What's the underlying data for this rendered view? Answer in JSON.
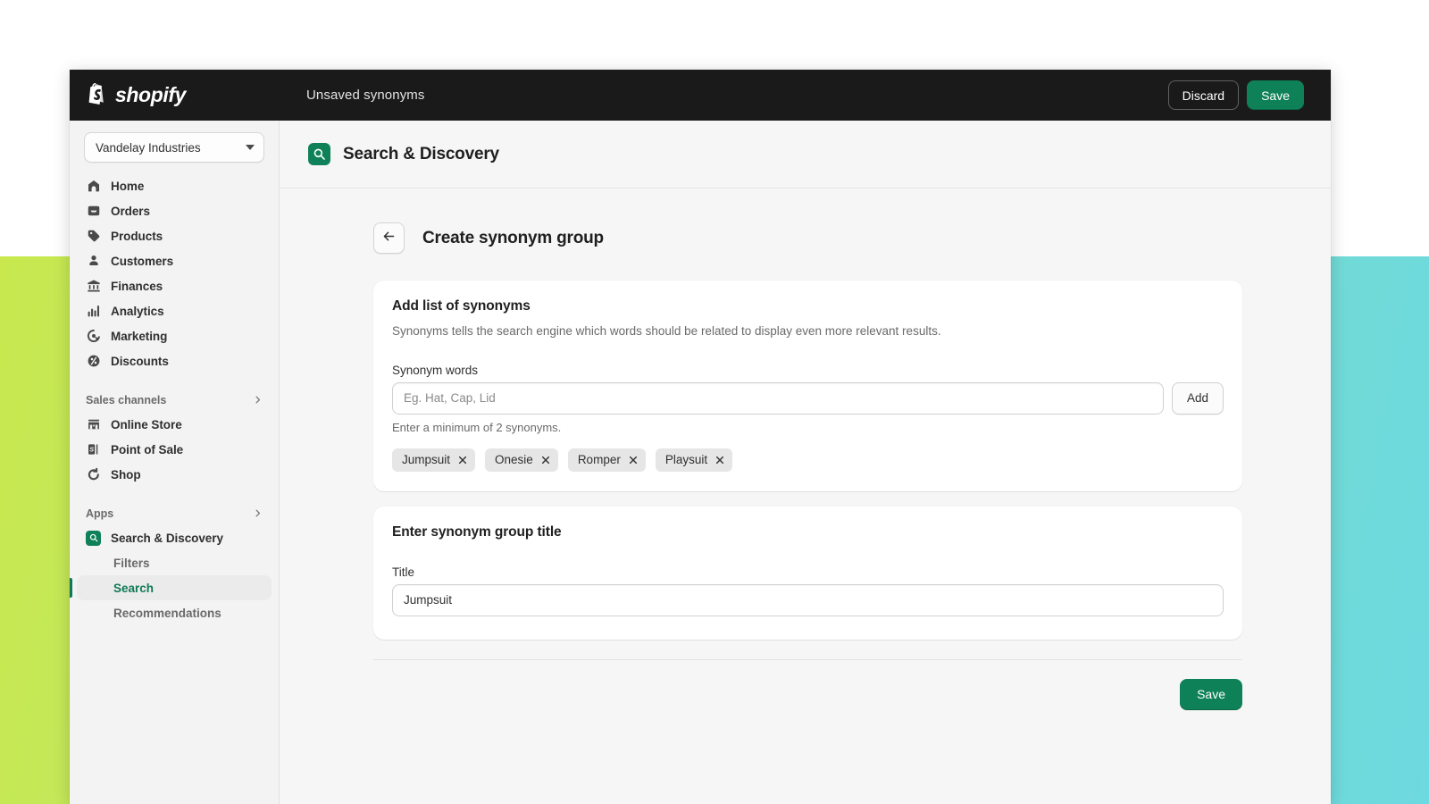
{
  "topbar": {
    "brand": "shopify",
    "brand_icon": "shopify-bag-icon",
    "title": "Unsaved synonyms",
    "discard_label": "Discard",
    "save_label": "Save"
  },
  "sidebar": {
    "store": {
      "name": "Vandelay Industries",
      "caret_icon": "chevron-down-icon"
    },
    "nav": [
      {
        "label": "Home",
        "icon": "home-icon"
      },
      {
        "label": "Orders",
        "icon": "orders-inbox-icon"
      },
      {
        "label": "Products",
        "icon": "product-tag-icon"
      },
      {
        "label": "Customers",
        "icon": "person-icon"
      },
      {
        "label": "Finances",
        "icon": "bank-icon"
      },
      {
        "label": "Analytics",
        "icon": "bar-chart-icon"
      },
      {
        "label": "Marketing",
        "icon": "megaphone-target-icon"
      },
      {
        "label": "Discounts",
        "icon": "discount-percent-icon"
      }
    ],
    "sales_channels": {
      "label": "Sales channels",
      "chevron_icon": "chevron-right-icon",
      "items": [
        {
          "label": "Online Store",
          "icon": "storefront-icon"
        },
        {
          "label": "Point of Sale",
          "icon": "pos-device-icon"
        },
        {
          "label": "Shop",
          "icon": "shop-bag-icon"
        }
      ]
    },
    "apps": {
      "label": "Apps",
      "chevron_icon": "chevron-right-icon",
      "items": [
        {
          "label": "Search & Discovery",
          "icon": "search-discovery-app-icon"
        }
      ],
      "sub_items": [
        {
          "label": "Filters",
          "active": false
        },
        {
          "label": "Search",
          "active": true
        },
        {
          "label": "Recommendations",
          "active": false
        }
      ]
    }
  },
  "app_header": {
    "icon": "search-discovery-app-icon",
    "title": "Search & Discovery"
  },
  "page": {
    "back_icon": "arrow-left-icon",
    "title": "Create synonym group"
  },
  "synonyms_card": {
    "title": "Add list of synonyms",
    "description": "Synonyms tells the search engine which words should be related to display even more relevant results.",
    "field_label": "Synonym words",
    "input_value": "",
    "input_placeholder": "Eg. Hat, Cap, Lid",
    "add_label": "Add",
    "help_text": "Enter a minimum of 2 synonyms.",
    "chips": [
      {
        "label": "Jumpsuit",
        "remove_icon": "close-icon"
      },
      {
        "label": "Onesie",
        "remove_icon": "close-icon"
      },
      {
        "label": "Romper",
        "remove_icon": "close-icon"
      },
      {
        "label": "Playsuit",
        "remove_icon": "close-icon"
      }
    ]
  },
  "title_card": {
    "title": "Enter synonym group title",
    "field_label": "Title",
    "input_value": "Jumpsuit",
    "input_placeholder": ""
  },
  "footer": {
    "save_label": "Save"
  },
  "colors": {
    "brand_green": "#0f8159",
    "active_green": "#0f7a56",
    "topbar_black": "#1a1a1a",
    "sidebar_bg": "#f3f3f3",
    "main_bg": "#f6f6f7",
    "card_bg": "#ffffff",
    "chip_bg": "#e6e6e6",
    "backdrop_start": "#c8e84e",
    "backdrop_end": "#6dd9e0"
  }
}
